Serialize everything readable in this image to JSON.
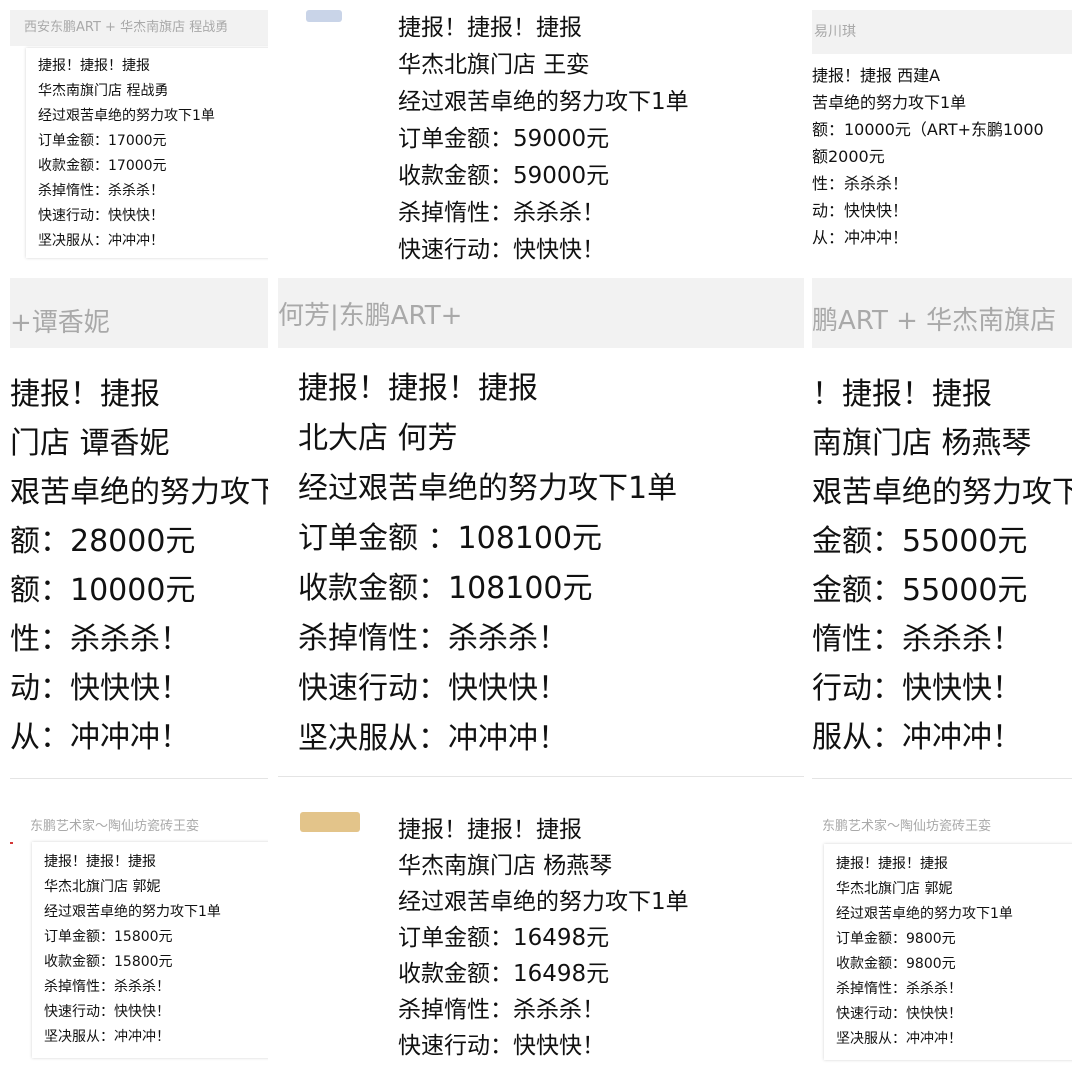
{
  "panels": [
    {
      "header": "西安东鹏ART + 华杰南旗店 程战勇",
      "lines": [
        "捷报！捷报！捷报",
        "华杰南旗门店  程战勇",
        "经过艰苦卓绝的努力攻下1单",
        "订单金额：17000元",
        "收款金额：17000元",
        "杀掉惰性：杀杀杀！",
        "快速行动：快快快！",
        "坚决服从：冲冲冲！"
      ]
    },
    {
      "header": "",
      "lines": [
        "捷报！捷报！捷报",
        "华杰北旗门店 王娈",
        "经过艰苦卓绝的努力攻下1单",
        "订单金额：59000元",
        "收款金额：59000元",
        "杀掉惰性：杀杀杀！",
        "快速行动：快快快！"
      ]
    },
    {
      "header": "易川琪",
      "lines": [
        "捷报！捷报                    西建A",
        "苦卓绝的努力攻下1单",
        "额：10000元（ART+东鹏1000",
        "额2000元",
        "性：杀杀杀！",
        "动：快快快！",
        "从：冲冲冲！"
      ]
    },
    {
      "header": "+谭香妮",
      "lines": [
        " 捷报！捷报",
        "门店  谭香妮",
        "艰苦卓绝的努力攻下",
        "额：28000元",
        "额：10000元",
        "性：杀杀杀！",
        "动：快快快！",
        "从：冲冲冲！"
      ]
    },
    {
      "header": "何芳|东鹏ART+",
      "lines": [
        "捷报！捷报！捷报",
        "北大店 何芳",
        "经过艰苦卓绝的努力攻下1单",
        "订单金额 ：108100元",
        "收款金额：108100元",
        "杀掉惰性：杀杀杀！",
        "快速行动：快快快！",
        "坚决服从：冲冲冲！"
      ]
    },
    {
      "header": "鹏ART + 华杰南旗店",
      "lines": [
        "！捷报！捷报",
        "南旗门店  杨燕琴",
        "艰苦卓绝的努力攻下",
        "金额：55000元",
        "金额：55000元",
        "惰性：杀杀杀！",
        "行动：快快快！",
        "服从：冲冲冲！"
      ]
    },
    {
      "header": "东鹏艺术家～陶仙坊瓷砖王娈",
      "lines": [
        "捷报！捷报！捷报",
        "华杰北旗门店 郭妮",
        "经过艰苦卓绝的努力攻下1单",
        "订单金额：15800元",
        "收款金额：15800元",
        "杀掉惰性：杀杀杀！",
        "快速行动：快快快！",
        "坚决服从：冲冲冲！"
      ]
    },
    {
      "header": "",
      "lines": [
        "捷报！捷报！捷报",
        "华杰南旗门店  杨燕琴",
        "经过艰苦卓绝的努力攻下1单",
        "订单金额：16498元",
        "收款金额：16498元",
        "杀掉惰性：杀杀杀！",
        "快速行动：快快快！"
      ]
    },
    {
      "header": "东鹏艺术家～陶仙坊瓷砖王娈",
      "lines": [
        "捷报！捷报！捷报",
        "华杰北旗门店 郭妮",
        "经过艰苦卓绝的努力攻下1单",
        "订单金额：9800元",
        "收款金额：9800元",
        "杀掉惰性：杀杀杀！",
        "快速行动：快快快！",
        "坚决服从：冲冲冲！"
      ]
    }
  ]
}
